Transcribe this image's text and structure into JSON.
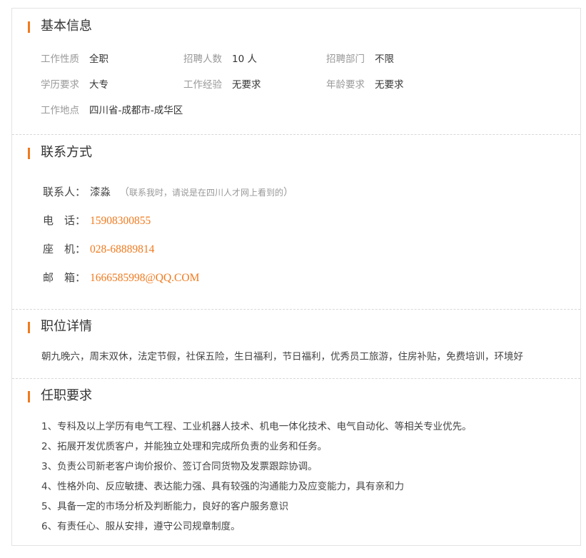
{
  "basic_info": {
    "title": "基本信息",
    "fields": [
      {
        "label": "工作性质",
        "value": "全职"
      },
      {
        "label": "招聘人数",
        "value": "10 人"
      },
      {
        "label": "招聘部门",
        "value": "不限"
      },
      {
        "label": "学历要求",
        "value": "大专"
      },
      {
        "label": "工作经验",
        "value": "无要求"
      },
      {
        "label": "年龄要求",
        "value": "无要求"
      },
      {
        "label": "工作地点",
        "value": "四川省-成都市-成华区"
      }
    ]
  },
  "contact": {
    "title": "联系方式",
    "person_label": "联系人：",
    "person_name": "漆淼",
    "paren_open": "（",
    "person_note": "联系我时，请说是在四川人才网上看到的",
    "paren_close": "）",
    "phone_label": "电　话：",
    "phone": "15908300855",
    "landline_label": "座　机：",
    "landline": "028-68889814",
    "email_label": "邮　箱：",
    "email": "1666585998@QQ.COM"
  },
  "position_details": {
    "title": "职位详情",
    "benefits": "朝九晚六，周末双休，法定节假，社保五险，生日福利，节日福利，优秀员工旅游，住房补贴，免费培训，环境好"
  },
  "requirements": {
    "title": "任职要求",
    "items": [
      "1、专科及以上学历有电气工程、工业机器人技术、机电一体化技术、电气自动化、等相关专业优先。",
      "2、拓展开发优质客户，并能独立处理和完成所负责的业务和任务。",
      "3、负责公司新老客户询价报价、签订合同货物及发票跟踪协调。",
      "4、性格外向、反应敏捷、表达能力强、具有较强的沟通能力及应变能力，具有亲和力",
      "5、具备一定的市场分析及判断能力，良好的客户服务意识",
      "6、有责任心、服从安排，遵守公司规章制度。"
    ]
  },
  "colors": {
    "accent": "#f07a1e",
    "label_gray": "#999999",
    "text": "#333333"
  }
}
